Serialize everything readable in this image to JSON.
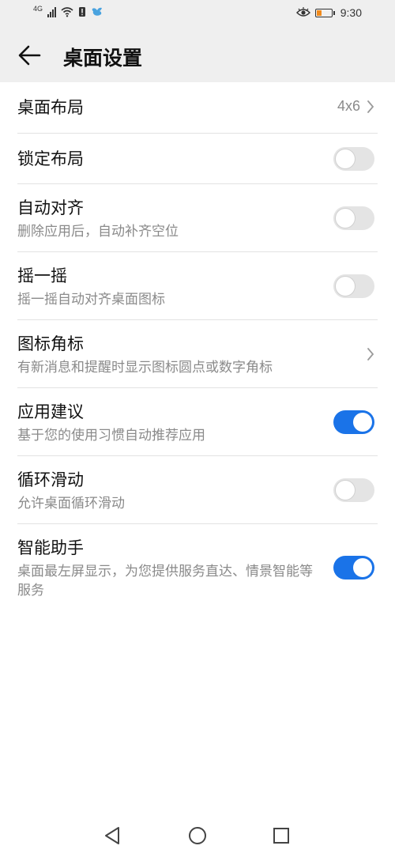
{
  "status_bar": {
    "network": "4G",
    "time": "9:30"
  },
  "header": {
    "title": "桌面设置"
  },
  "settings": [
    {
      "title": "桌面布局",
      "subtitle": "",
      "value": "4x6",
      "control": "chevron"
    },
    {
      "title": "锁定布局",
      "subtitle": "",
      "control": "toggle",
      "on": false
    },
    {
      "title": "自动对齐",
      "subtitle": "删除应用后，自动补齐空位",
      "control": "toggle",
      "on": false
    },
    {
      "title": "摇一摇",
      "subtitle": "摇一摇自动对齐桌面图标",
      "control": "toggle",
      "on": false
    },
    {
      "title": "图标角标",
      "subtitle": "有新消息和提醒时显示图标圆点或数字角标",
      "control": "chevron"
    },
    {
      "title": "应用建议",
      "subtitle": "基于您的使用习惯自动推荐应用",
      "control": "toggle",
      "on": true
    },
    {
      "title": "循环滑动",
      "subtitle": "允许桌面循环滑动",
      "control": "toggle",
      "on": false
    },
    {
      "title": "智能助手",
      "subtitle": "桌面最左屏显示，为您提供服务直达、情景智能等服务",
      "control": "toggle",
      "on": true
    }
  ],
  "colors": {
    "accent": "#1a73e8",
    "header_bg": "#efefef",
    "subtitle": "#8a8a8a",
    "toggle_off": "#e4e4e4",
    "battery_low": "#f08a1c"
  },
  "icons": {
    "back": "arrow-left-icon",
    "chevron": "chevron-right-icon",
    "nav_back": "triangle-back-icon",
    "nav_home": "circle-home-icon",
    "nav_recent": "square-recent-icon"
  }
}
